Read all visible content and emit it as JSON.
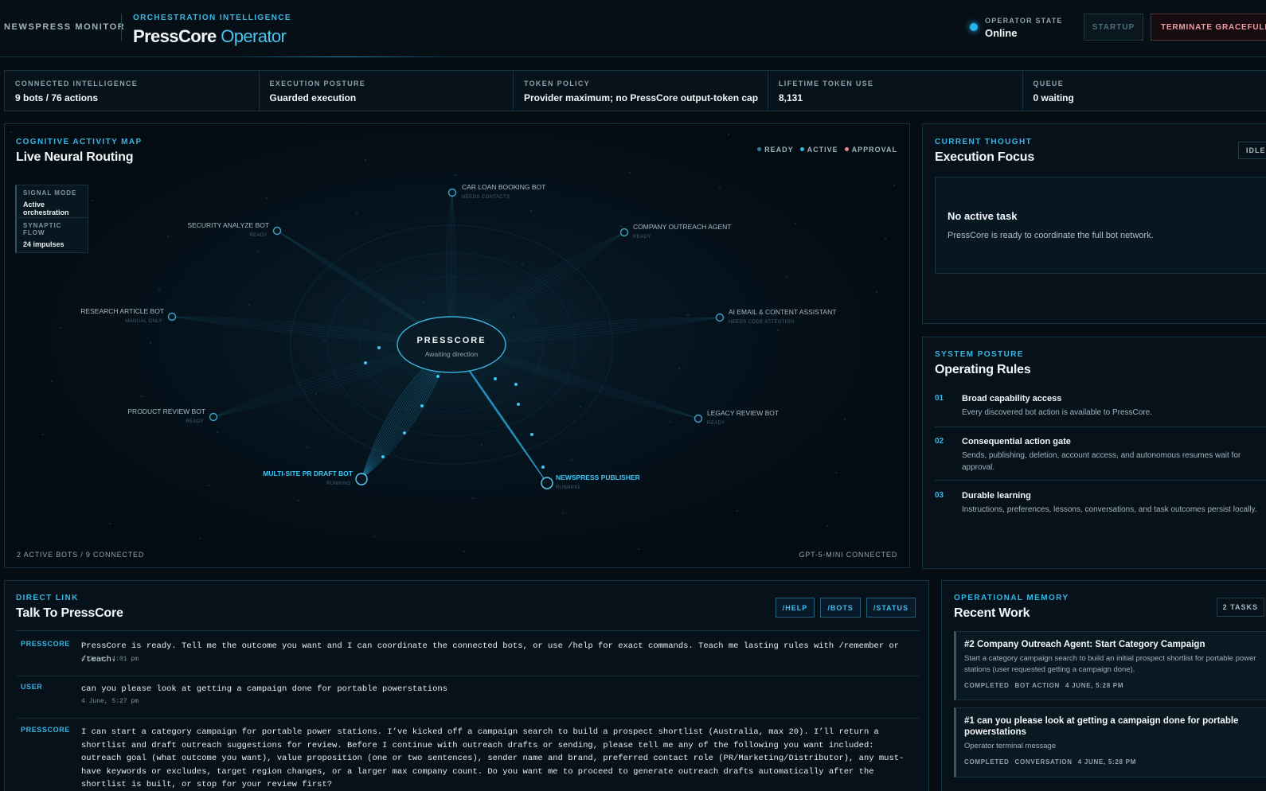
{
  "header": {
    "brand": "NEWSPRESS MONITOR",
    "eyebrow": "ORCHESTRATION INTELLIGENCE",
    "title_main": "PressCore",
    "title_accent": "Operator",
    "operator_state_label": "OPERATOR STATE",
    "operator_state_value": "Online",
    "startup_label": "STARTUP",
    "terminate_label": "TERMINATE GRACEFULLY"
  },
  "stats": [
    {
      "label": "CONNECTED INTELLIGENCE",
      "value": "9 bots / 76 actions"
    },
    {
      "label": "EXECUTION POSTURE",
      "value": "Guarded execution"
    },
    {
      "label": "TOKEN POLICY",
      "value": "Provider maximum; no PressCore output-token cap"
    },
    {
      "label": "LIFETIME TOKEN USE",
      "value": "8,131"
    },
    {
      "label": "QUEUE",
      "value": "0 waiting"
    }
  ],
  "map": {
    "eyebrow": "COGNITIVE ACTIVITY MAP",
    "title": "Live Neural Routing",
    "legend": [
      {
        "label": "READY",
        "color": "#2f7f9c"
      },
      {
        "label": "ACTIVE",
        "color": "#2bb8ee"
      },
      {
        "label": "APPROVAL",
        "color": "#e58a86"
      }
    ],
    "signal_mode_label": "SIGNAL MODE",
    "signal_mode_value": "Active orchestration",
    "synaptic_flow_label": "SYNAPTIC FLOW",
    "synaptic_flow_value": "24 impulses",
    "core_name": "PRESSCORE",
    "core_status": "Awaiting direction",
    "nodes": [
      {
        "name": "CAR LOAN BOOKING BOT",
        "status": "NEEDS CONTACTS",
        "active": false
      },
      {
        "name": "SECURITY ANALYZE BOT",
        "status": "READY",
        "active": false
      },
      {
        "name": "COMPANY OUTREACH AGENT",
        "status": "READY",
        "active": false
      },
      {
        "name": "RESEARCH ARTICLE BOT",
        "status": "MANUAL ONLY",
        "active": false
      },
      {
        "name": "AI EMAIL & CONTENT ASSISTANT",
        "status": "NEEDS CODE ATTENTION",
        "active": false
      },
      {
        "name": "PRODUCT REVIEW BOT",
        "status": "READY",
        "active": false
      },
      {
        "name": "LEGACY REVIEW BOT",
        "status": "READY",
        "active": false
      },
      {
        "name": "MULTI-SITE PR DRAFT BOT",
        "status": "RUNNING",
        "active": true
      },
      {
        "name": "NEWSPRESS PUBLISHER",
        "status": "RUNNING",
        "active": true
      }
    ],
    "footer_left": "2 ACTIVE BOTS / 9 CONNECTED",
    "footer_right": "GPT-5-MINI CONNECTED"
  },
  "focus": {
    "eyebrow": "CURRENT THOUGHT",
    "title": "Execution Focus",
    "badge": "IDLE",
    "heading": "No active task",
    "text": "PressCore is ready to coordinate the full bot network."
  },
  "rules": {
    "eyebrow": "SYSTEM POSTURE",
    "title": "Operating Rules",
    "items": [
      {
        "num": "01",
        "title": "Broad capability access",
        "desc": "Every discovered bot action is available to PressCore."
      },
      {
        "num": "02",
        "title": "Consequential action gate",
        "desc": "Sends, publishing, deletion, account access, and autonomous resumes wait for approval."
      },
      {
        "num": "03",
        "title": "Durable learning",
        "desc": "Instructions, preferences, lessons, conversations, and task outcomes persist locally."
      }
    ]
  },
  "chat": {
    "eyebrow": "DIRECT LINK",
    "title": "Talk To PressCore",
    "buttons": [
      "/HELP",
      "/BOTS",
      "/STATUS"
    ],
    "messages": [
      {
        "who": "PRESSCORE",
        "text": "PressCore is ready. Tell me the outcome you want and I can coordinate the connected bots, or use /help for exact commands. Teach me lasting rules with /remember or /teach.",
        "time": "4 June, 4:01 pm"
      },
      {
        "who": "USER",
        "text": "can you please look at getting a campaign done for portable powerstations",
        "time": "4 June, 5:27 pm"
      },
      {
        "who": "PRESSCORE",
        "text": "I can start a category campaign for portable power stations. I’ve kicked off a campaign search to build a prospect shortlist (Australia, max 20). I’ll return a shortlist and draft outreach suggestions for review. Before I continue with outreach drafts or sending, please tell me any of the following you want included: outreach goal (what outcome you want), value proposition (one or two sentences), sender name and brand, preferred contact role (PR/Marketing/Distributor), any must-have keywords or excludes, target region changes, or a larger max company count. Do you want me to proceed to generate outreach drafts automatically after the shortlist is built, or stop for your review first?",
        "time": ""
      }
    ]
  },
  "memory": {
    "eyebrow": "OPERATIONAL MEMORY",
    "title": "Recent Work",
    "badge": "2 TASKS",
    "items": [
      {
        "title": "#2 Company Outreach Agent: Start Category Campaign",
        "desc": "Start a category campaign search to build an initial prospect shortlist for portable power stations (user requested getting a campaign done).",
        "status": "COMPLETED",
        "kind": "BOT ACTION",
        "time": "4 JUNE, 5:28 PM"
      },
      {
        "title": "#1 can you please look at getting a campaign done for portable powerstations",
        "desc": "Operator terminal message",
        "status": "COMPLETED",
        "kind": "CONVERSATION",
        "time": "4 JUNE, 5:28 PM"
      }
    ]
  }
}
